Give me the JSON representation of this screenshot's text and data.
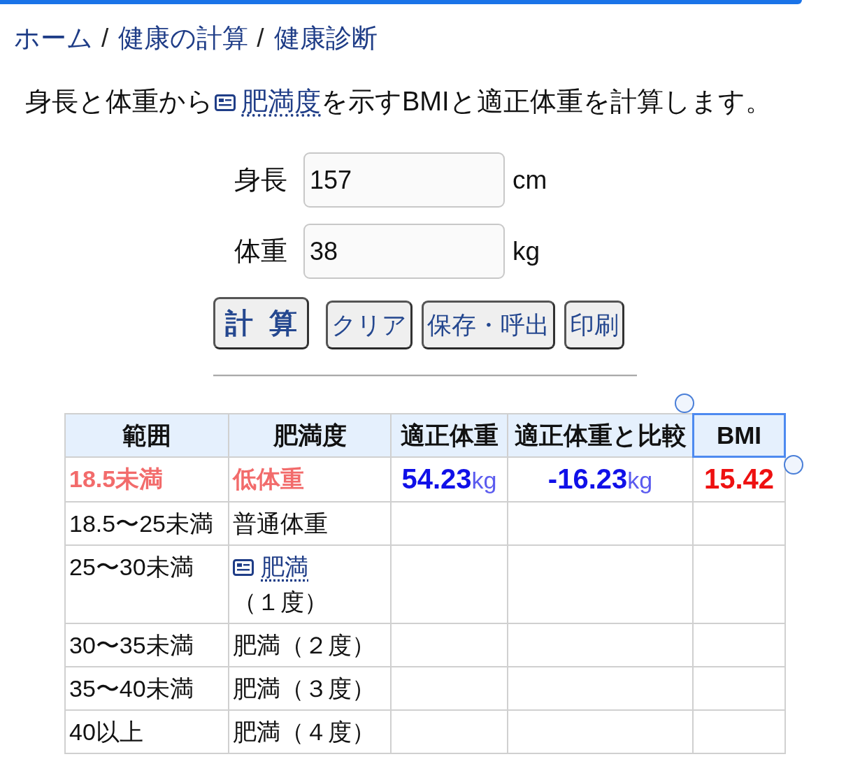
{
  "progress": {
    "level": 0.94
  },
  "breadcrumb": {
    "items": [
      "ホーム",
      "健康の計算",
      "健康診断"
    ],
    "separators": [
      "/",
      "/"
    ]
  },
  "intro": {
    "before": "身長と体重から",
    "link": "肥満度",
    "after": "を示すBMIと適正体重を計算します。"
  },
  "form": {
    "fields": [
      {
        "label": "身長",
        "value": "157",
        "unit": "cm"
      },
      {
        "label": "体重",
        "value": "38",
        "unit": "kg"
      }
    ],
    "buttons": [
      {
        "label": "計 算",
        "kind": "primary"
      },
      {
        "label": "クリア",
        "kind": "secondary"
      },
      {
        "label": "保存・呼出",
        "kind": "secondary"
      },
      {
        "label": "印刷",
        "kind": "secondary"
      }
    ]
  },
  "table": {
    "columns": [
      {
        "label": "範囲",
        "selected": false
      },
      {
        "label": "肥満度",
        "selected": false
      },
      {
        "label": "適正体重",
        "selected": false
      },
      {
        "label": "適正体重と比較",
        "selected": false
      },
      {
        "label": "BMI",
        "selected": true
      }
    ],
    "rows": [
      {
        "range": "18.5未満",
        "category": "低体重",
        "highlighted": true,
        "ideal_weight": "**54.23**kg",
        "difference": "**-16.23**kg",
        "bmi": "15.42"
      },
      {
        "range": "18.5〜25未満",
        "category": "普通体重",
        "highlighted": false
      },
      {
        "range": "25〜30未満",
        "category_link": "肥満",
        "category": "（１度）",
        "highlighted": false
      },
      {
        "range": "30〜35未満",
        "category": "肥満（２度）",
        "highlighted": false
      },
      {
        "range": "35〜40未満",
        "category": "肥満（３度）",
        "highlighted": false
      },
      {
        "range": "40以上",
        "category": "肥満（４度）",
        "highlighted": false
      }
    ]
  }
}
